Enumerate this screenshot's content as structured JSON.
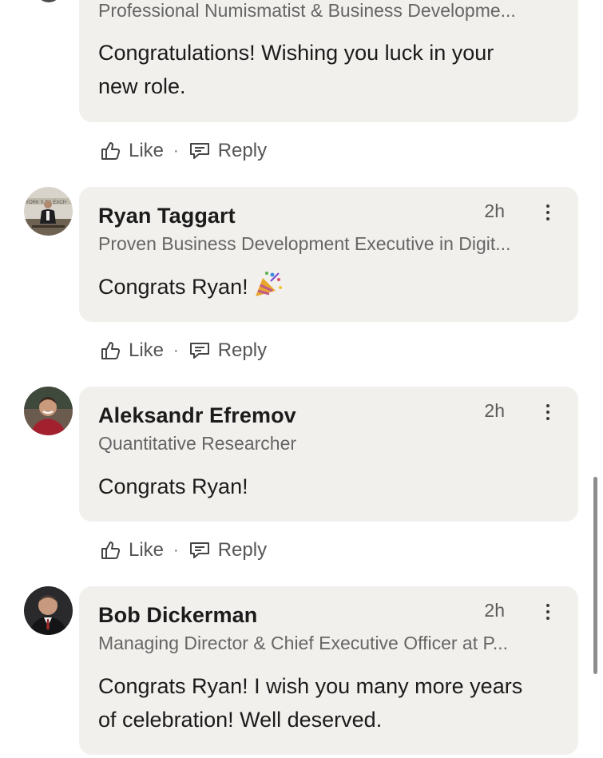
{
  "comments": [
    {
      "name": "",
      "headline": "Professional Numismatist & Business Developme...",
      "message_lines": [
        "Congratulations! Wishing you luck in your",
        "new role."
      ],
      "time": ""
    },
    {
      "name": "Ryan Taggart",
      "headline": "Proven Business Development Executive in Digit...",
      "message": "Congrats Ryan!",
      "emoji": "party-popper",
      "time": "2h"
    },
    {
      "name": "Aleksandr Efremov",
      "headline": "Quantitative Researcher",
      "message": "Congrats Ryan!",
      "time": "2h"
    },
    {
      "name": "Bob Dickerman",
      "headline": "Managing Director & Chief Executive Officer at P...",
      "message_lines": [
        "Congrats Ryan! I wish you many more years",
        "of celebration! Well deserved."
      ],
      "time": "2h"
    }
  ],
  "actions": {
    "like": "Like",
    "reply": "Reply",
    "separator": "·"
  },
  "icons": {
    "like": "thumbs-up-outline-icon",
    "reply": "speech-bubble-outline-icon",
    "more": "vertical-ellipsis-icon"
  },
  "colors": {
    "bubble": "#f2f0ed",
    "text": "#1b1b1b",
    "muted": "#666666"
  }
}
